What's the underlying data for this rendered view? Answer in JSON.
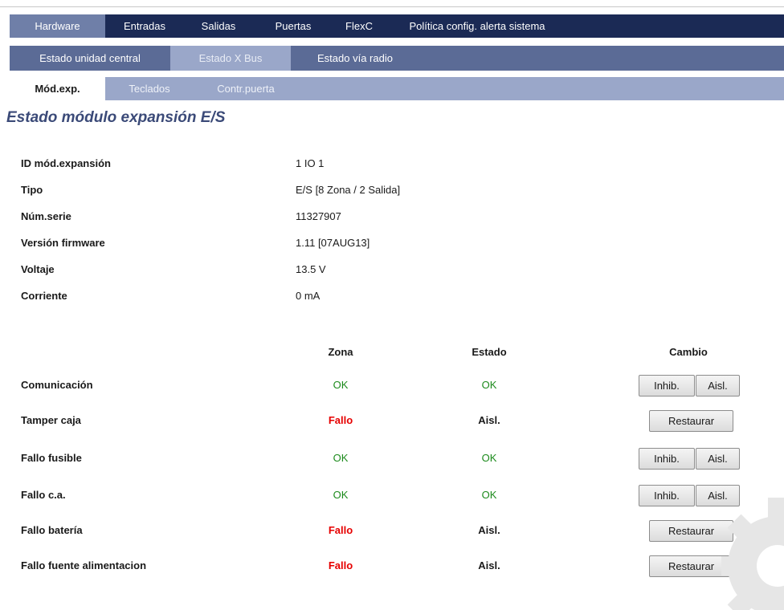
{
  "nav": {
    "main_tabs": [
      "Hardware",
      "Entradas",
      "Salidas",
      "Puertas",
      "FlexC",
      "Política config. alerta sistema"
    ],
    "sub_tabs": [
      "Estado unidad central",
      "Estado X Bus",
      "Estado vía radio"
    ],
    "subsub_tabs": [
      "Mód.exp.",
      "Teclados",
      "Contr.puerta"
    ]
  },
  "page_title": "Estado módulo expansión E/S",
  "info": [
    {
      "label": "ID mód.expansión",
      "value": "1 IO 1"
    },
    {
      "label": "Tipo",
      "value": "E/S [8 Zona / 2 Salida]"
    },
    {
      "label": "Núm.serie",
      "value": "11327907"
    },
    {
      "label": "Versión firmware",
      "value": "1.11 [07AUG13]"
    },
    {
      "label": "Voltaje",
      "value": "13.5 V"
    },
    {
      "label": "Corriente",
      "value": "0 mA"
    }
  ],
  "table": {
    "headers": {
      "zona": "Zona",
      "estado": "Estado",
      "cambio": "Cambio"
    },
    "rows": [
      {
        "label": "Comunicación",
        "zona": "OK",
        "estado": "OK",
        "buttons": [
          "Inhib.",
          "Aisl."
        ]
      },
      {
        "label": "Tamper caja",
        "zona": "Fallo",
        "estado": "Aisl.",
        "buttons": [
          "Restaurar"
        ]
      },
      {
        "label": "Fallo fusible",
        "zona": "OK",
        "estado": "OK",
        "buttons": [
          "Inhib.",
          "Aisl."
        ]
      },
      {
        "label": "Fallo c.a.",
        "zona": "OK",
        "estado": "OK",
        "buttons": [
          "Inhib.",
          "Aisl."
        ]
      },
      {
        "label": "Fallo batería",
        "zona": "Fallo",
        "estado": "Aisl.",
        "buttons": [
          "Restaurar"
        ]
      },
      {
        "label": "Fallo fuente alimentacion",
        "zona": "Fallo",
        "estado": "Aisl.",
        "buttons": [
          "Restaurar"
        ]
      }
    ]
  },
  "colors": {
    "ok": "#1b8a1b",
    "fail": "#e60000",
    "nav_dark": "#1b2a55",
    "title": "#3b4a78"
  }
}
